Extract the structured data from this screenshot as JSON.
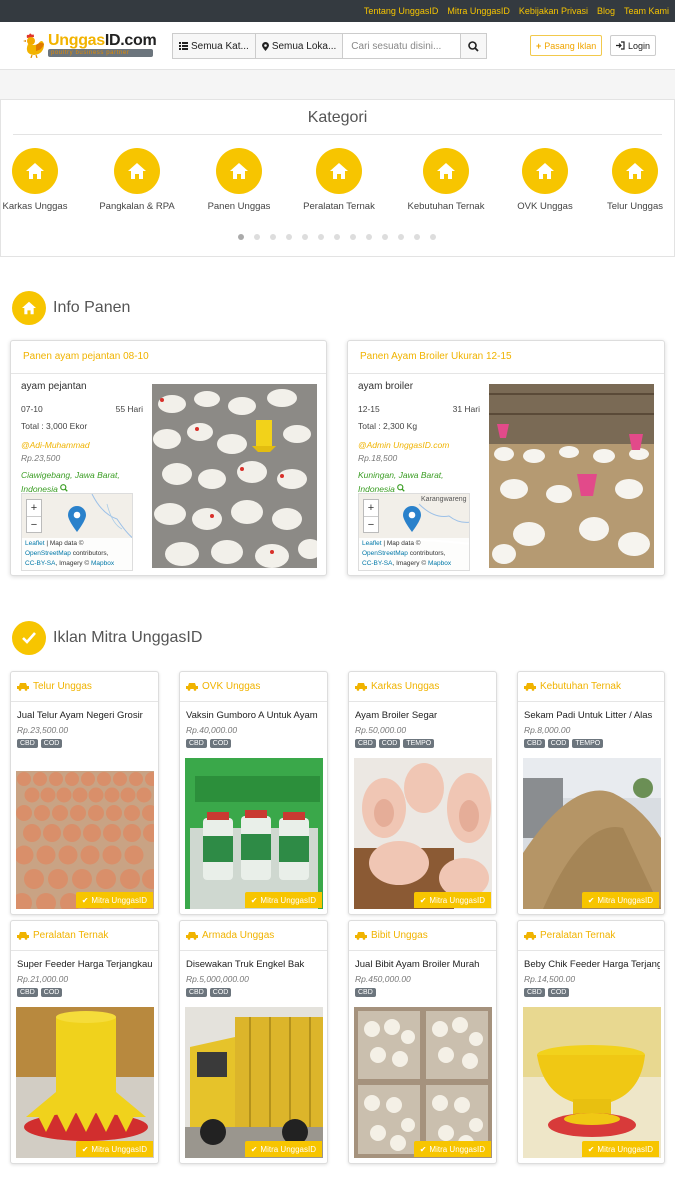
{
  "topnav": [
    "Tentang UnggasID",
    "Mitra UnggasID",
    "Kebijakan Privasi",
    "Blog",
    "Team Kami"
  ],
  "brand": {
    "name_a": "Unggas",
    "name_b": "ID.com",
    "tagline": "poultry business partner"
  },
  "search": {
    "category": "Semua Kat...",
    "location": "Semua Loka...",
    "placeholder": "Cari sesuatu disini..."
  },
  "actions": {
    "post_ad": "Pasang Iklan",
    "login": "Login"
  },
  "kategori": {
    "title": "Kategori",
    "items": [
      "Karkas Unggas",
      "Pangkalan & RPA",
      "Panen Unggas",
      "Peralatan Ternak",
      "Kebutuhan Ternak",
      "OVK Unggas",
      "Telur Unggas"
    ],
    "active_dot": 0,
    "dot_count": 13
  },
  "info_panen": {
    "title": "Info Panen",
    "cards": [
      {
        "header": "Panen ayam pejantan 08-10",
        "name": "ayam pejantan",
        "range": "07-10",
        "days": "55 Hari",
        "total": "Total : 3,000 Ekor",
        "author": "@Adi-Muhammad",
        "price": "Rp.23,500",
        "location": "Ciawigebang, Jawa Barat, Indonesia",
        "map_label": ""
      },
      {
        "header": "Panen Ayam Broiler Ukuran 12-15",
        "name": "ayam broiler",
        "range": "12-15",
        "days": "31 Hari",
        "total": "Total : 2,300 Kg",
        "author": "@Admin UnggasID.com",
        "price": "Rp.18,500",
        "location": "Kuningan, Jawa Barat, Indonesia",
        "map_label": "Karangwareng"
      }
    ],
    "map_attr": {
      "a": "Leaflet",
      "b": " | Map data © ",
      "c": "OpenStreetMap",
      "d": " contributors, ",
      "e": "CC-BY-SA",
      "f": ", Imagery © ",
      "g": "Mapbox"
    }
  },
  "mitra": {
    "title": "Iklan Mitra UnggasID",
    "badge": "Mitra UnggasID",
    "items": [
      {
        "category": "Telur Unggas",
        "title": "Jual Telur Ayam Negeri Grosir",
        "price": "Rp.23,500.00",
        "tags": [
          "CBD",
          "COD"
        ]
      },
      {
        "category": "OVK Unggas",
        "title": "Vaksin Gumboro A Untuk Ayam",
        "price": "Rp.40,000.00",
        "tags": [
          "CBD",
          "COD"
        ]
      },
      {
        "category": "Karkas Unggas",
        "title": "Ayam Broiler Segar",
        "price": "Rp.50,000.00",
        "tags": [
          "CBD",
          "COD",
          "TEMPO"
        ]
      },
      {
        "category": "Kebutuhan Ternak",
        "title": "Sekam Padi Untuk Litter / Alas",
        "price": "Rp.8,000.00",
        "tags": [
          "CBD",
          "COD",
          "TEMPO"
        ]
      },
      {
        "category": "Peralatan Ternak",
        "title": "Super Feeder Harga Terjangkau",
        "price": "Rp.21,000.00",
        "tags": [
          "CBD",
          "COD"
        ]
      },
      {
        "category": "Armada Unggas",
        "title": "Disewakan Truk Engkel Bak",
        "price": "Rp.5,000,000.00",
        "tags": [
          "CBD",
          "COD"
        ]
      },
      {
        "category": "Bibit Unggas",
        "title": "Jual Bibit Ayam Broiler Murah",
        "price": "Rp.450,000.00",
        "tags": [
          "CBD"
        ]
      },
      {
        "category": "Peralatan Ternak",
        "title": "Beby Chik Feeder Harga Terjangkau",
        "price": "Rp.14,500.00",
        "tags": [
          "CBD",
          "COD"
        ]
      }
    ]
  },
  "colors": {
    "accent": "#f7c500",
    "topbar": "#343a40",
    "location": "#3a9d23",
    "tag": "#6c757d"
  }
}
